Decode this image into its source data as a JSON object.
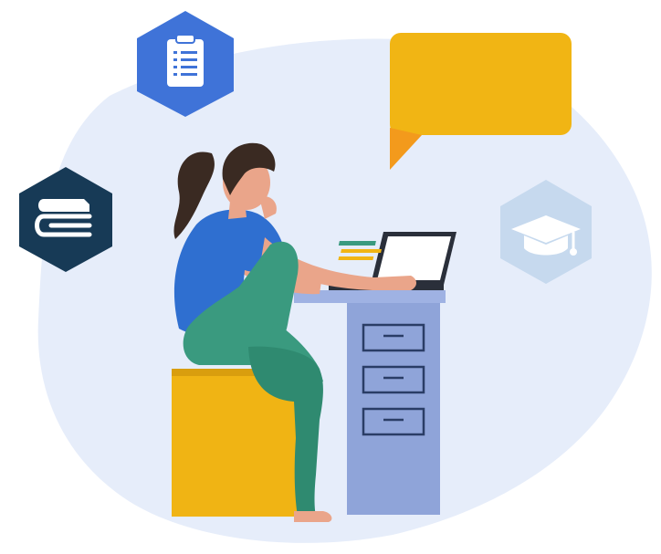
{
  "illustration": {
    "icons": [
      "checklist-document-icon",
      "books-icon",
      "graduation-cap-icon",
      "speech-bubble-icon"
    ],
    "colors": {
      "background_blob": "#e6edfa",
      "document_hex": "#3f73d8",
      "books_hex": "#173a56",
      "graduation_hex": "#c6d9ee",
      "speech_bubble": "#f1b514",
      "speech_bubble_tail": "#f39a1c",
      "shirt": "#2f6fd0",
      "pants": "#3a9a7f",
      "hair": "#3a2a22",
      "skin": "#eaa58a",
      "stool": "#f0b414",
      "desk_top": "#9fb2e3",
      "desk_cabinet": "#8fa4d9",
      "laptop": "#2a2f3a"
    }
  }
}
